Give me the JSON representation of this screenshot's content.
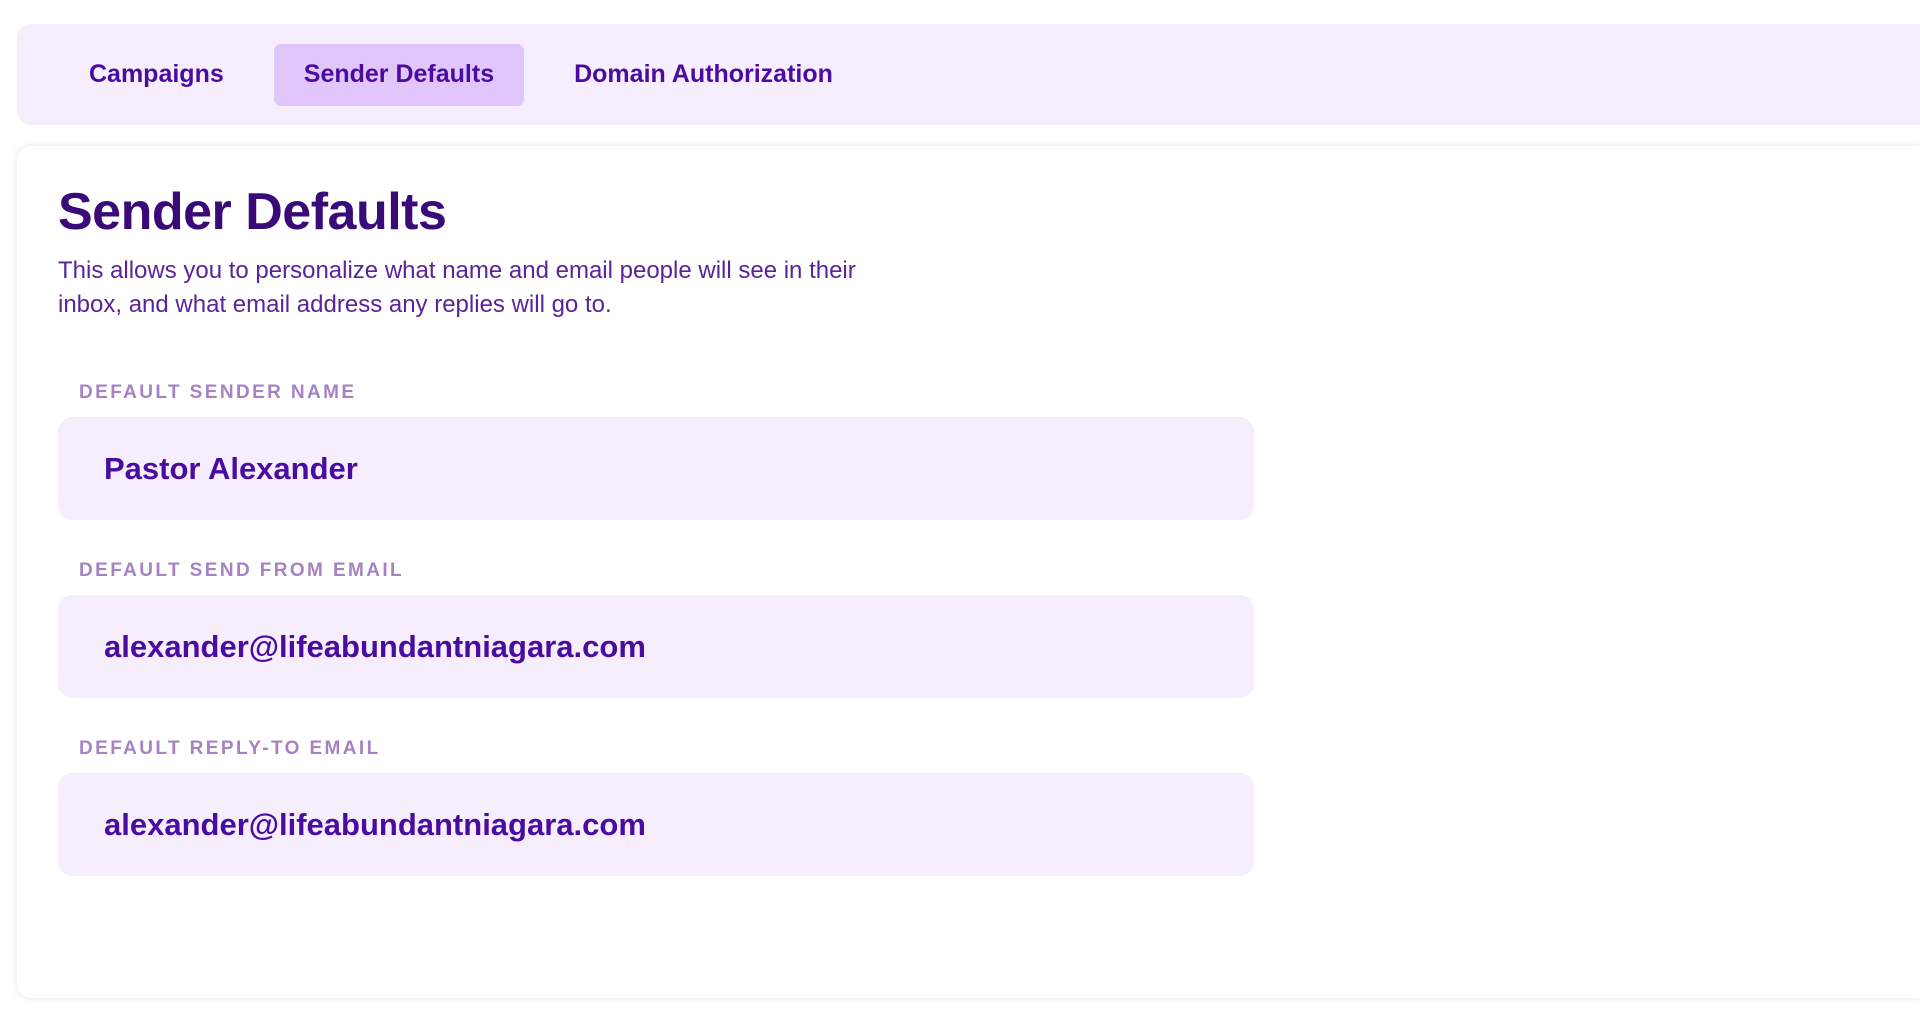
{
  "tabs": [
    {
      "label": "Campaigns",
      "active": false
    },
    {
      "label": "Sender Defaults",
      "active": true
    },
    {
      "label": "Domain Authorization",
      "active": false
    }
  ],
  "page": {
    "title": "Sender Defaults",
    "description": "This allows you to personalize what name and email people will see in their inbox, and what email address any replies will go to."
  },
  "fields": {
    "sender_name": {
      "label": "DEFAULT SENDER NAME",
      "value": "Pastor Alexander"
    },
    "send_from_email": {
      "label": "DEFAULT SEND FROM EMAIL",
      "value": "alexander@lifeabundantniagara.com"
    },
    "reply_to_email": {
      "label": "DEFAULT REPLY-TO EMAIL",
      "value": "alexander@lifeabundantniagara.com"
    }
  },
  "colors": {
    "accent": "#4a0ca0",
    "title": "#3a0a78",
    "tab_bar_bg": "#f6eefd",
    "active_tab_bg": "#e0c6fb",
    "field_bg": "#f6eefd",
    "label": "#a583c3"
  }
}
